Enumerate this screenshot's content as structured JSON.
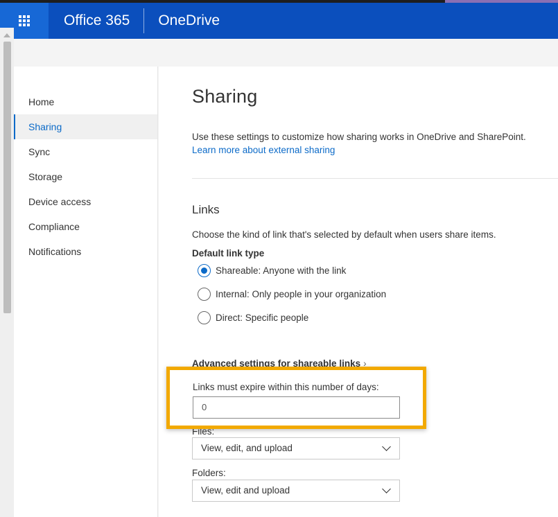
{
  "header": {
    "brand": "Office 365",
    "app_name": "OneDrive"
  },
  "nav": {
    "items": [
      {
        "label": "Home"
      },
      {
        "label": "Sharing",
        "active": true
      },
      {
        "label": "Sync"
      },
      {
        "label": "Storage"
      },
      {
        "label": "Device access"
      },
      {
        "label": "Compliance"
      },
      {
        "label": "Notifications"
      }
    ]
  },
  "main": {
    "title": "Sharing",
    "intro": "Use these settings to customize how sharing works in OneDrive and SharePoint.",
    "learn_more": "Learn more about external sharing",
    "links": {
      "title": "Links",
      "description": "Choose the kind of link that's selected by default when users share items.",
      "default_link_type_label": "Default link type",
      "options": [
        {
          "label": "Shareable: Anyone with the link",
          "checked": true
        },
        {
          "label": "Internal: Only people in your organization",
          "checked": false
        },
        {
          "label": "Direct: Specific people",
          "checked": false
        }
      ]
    },
    "advanced": {
      "label": "Advanced settings for shareable links",
      "chevron": "›",
      "files_label": "Files:",
      "files_value": "View, edit, and upload",
      "folders_label": "Folders:",
      "folders_value": "View, edit and upload"
    }
  },
  "callout": {
    "label": "Links must expire within this number of days:",
    "value": "0"
  },
  "colors": {
    "header_bg": "#0b4fbd",
    "waffle_bg": "#1768d6",
    "accent": "#0b6ac8",
    "highlight": "#f2a900"
  }
}
